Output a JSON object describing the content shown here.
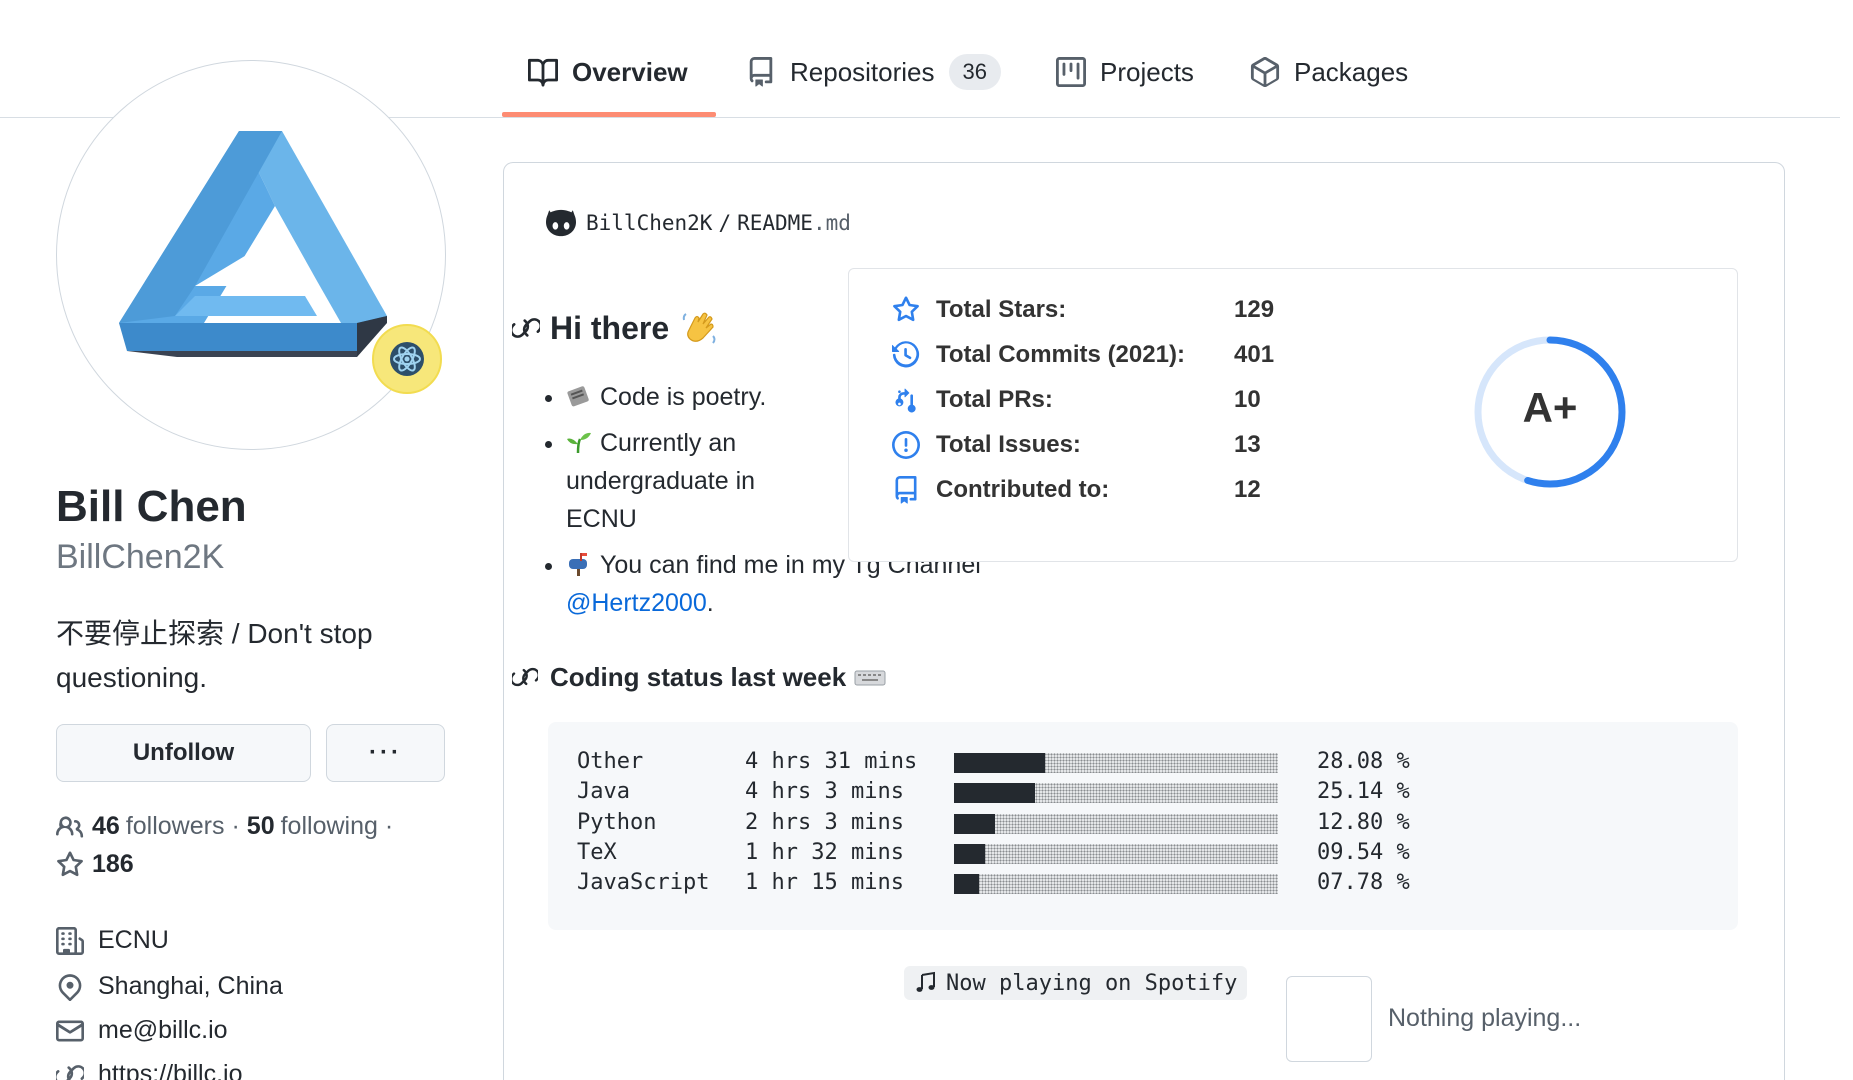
{
  "tabs": [
    {
      "label": "Overview",
      "icon": "book-icon",
      "active": true
    },
    {
      "label": "Repositories",
      "icon": "repo-icon",
      "count": "36"
    },
    {
      "label": "Projects",
      "icon": "project-icon"
    },
    {
      "label": "Packages",
      "icon": "package-icon"
    }
  ],
  "profile": {
    "name": "Bill Chen",
    "login": "BillChen2K",
    "bio": "不要停止探索 / Don't stop questioning.",
    "unfollow_label": "Unfollow",
    "more_label": "···",
    "followers_count": "46",
    "followers_label": "followers",
    "following_count": "50",
    "following_label": "following",
    "separator": "·",
    "stars": "186",
    "org": "ECNU",
    "location": "Shanghai, China",
    "email": "me@billc.io",
    "website": "https://billc.io"
  },
  "readme": {
    "owner": "BillChen2K",
    "slash": "/",
    "file": "README",
    "ext": ".md",
    "greeting": "Hi there",
    "bullets": [
      {
        "emoji": "newspaper",
        "text": "Code is poetry."
      },
      {
        "emoji": "seedling",
        "text": "Currently an undergraduate in ECNU"
      },
      {
        "emoji": "mailbox",
        "text": "You can find me in my Tg Channel ",
        "link": "@Hertz2000",
        "after": "."
      }
    ]
  },
  "stats": {
    "rows": [
      {
        "label": "Total Stars:",
        "value": "129",
        "icon": "star-icon"
      },
      {
        "label": "Total Commits (2021):",
        "value": "401",
        "icon": "history-icon"
      },
      {
        "label": "Total PRs:",
        "value": "10",
        "icon": "pull-request-icon"
      },
      {
        "label": "Total Issues:",
        "value": "13",
        "icon": "issue-icon"
      },
      {
        "label": "Contributed to:",
        "value": "12",
        "icon": "repo-icon"
      }
    ],
    "grade": "A+",
    "ring_fraction": 0.55,
    "accent": "#2f80ed"
  },
  "coding": {
    "title": "Coding status last week",
    "rows": [
      {
        "lang": "Other",
        "time": "4 hrs 31 mins",
        "pct": "28.08 %",
        "fraction": 0.2808
      },
      {
        "lang": "Java",
        "time": "4 hrs 3 mins",
        "pct": "25.14 %",
        "fraction": 0.2514
      },
      {
        "lang": "Python",
        "time": "2 hrs 3 mins",
        "pct": "12.80 %",
        "fraction": 0.128
      },
      {
        "lang": "TeX",
        "time": "1 hr 32 mins",
        "pct": "09.54 %",
        "fraction": 0.0954
      },
      {
        "lang": "JavaScript",
        "time": "1 hr 15 mins",
        "pct": "07.78 %",
        "fraction": 0.0778
      }
    ]
  },
  "spotify": {
    "label": "Now playing on Spotify",
    "status": "Nothing playing..."
  },
  "colors": {
    "tab_underline": "#fd8c73",
    "avatar_blue": "#5aa9e6",
    "link": "#0969da"
  }
}
